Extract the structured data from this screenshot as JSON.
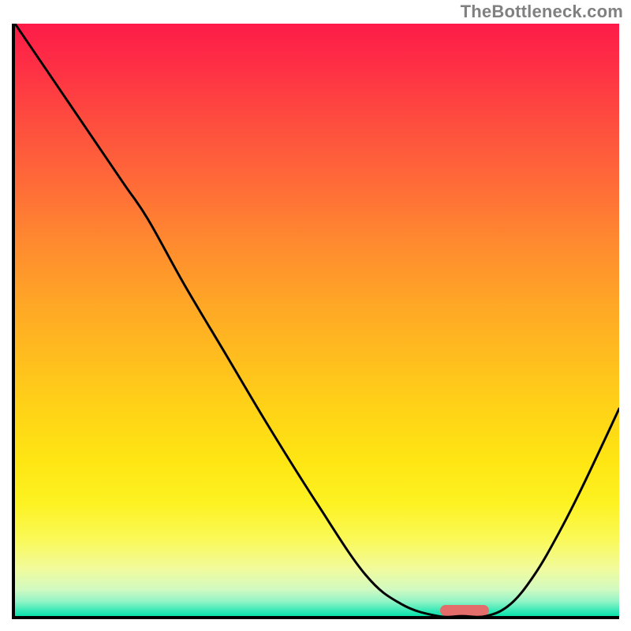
{
  "watermark": "TheBottleneck.com",
  "colors": {
    "curve": "#000000",
    "marker": "#e36d6a",
    "axis": "#000000",
    "watermark": "#808080"
  },
  "chart_data": {
    "type": "line",
    "title": "",
    "xlabel": "",
    "ylabel": "",
    "xlim": [
      0,
      100
    ],
    "ylim": [
      0,
      100
    ],
    "grid": false,
    "x": [
      0,
      6,
      12,
      18,
      22,
      28,
      35,
      42,
      50,
      58,
      64,
      70,
      74,
      78,
      82,
      86,
      90,
      94,
      100
    ],
    "values": [
      100,
      91,
      82,
      73,
      67,
      56,
      44,
      32,
      19,
      7,
      2,
      0,
      0,
      0,
      2,
      7,
      14,
      22,
      35
    ],
    "optimal_range": {
      "x_start": 70,
      "x_end": 78,
      "y": 1.5
    },
    "gradient_stops": [
      {
        "pct": 0,
        "color": "#fd1b48"
      },
      {
        "pct": 27,
        "color": "#ff6b38"
      },
      {
        "pct": 57,
        "color": "#ffbf1e"
      },
      {
        "pct": 81,
        "color": "#fdf222"
      },
      {
        "pct": 95,
        "color": "#d2fac1"
      },
      {
        "pct": 100,
        "color": "#08e3ad"
      }
    ]
  }
}
